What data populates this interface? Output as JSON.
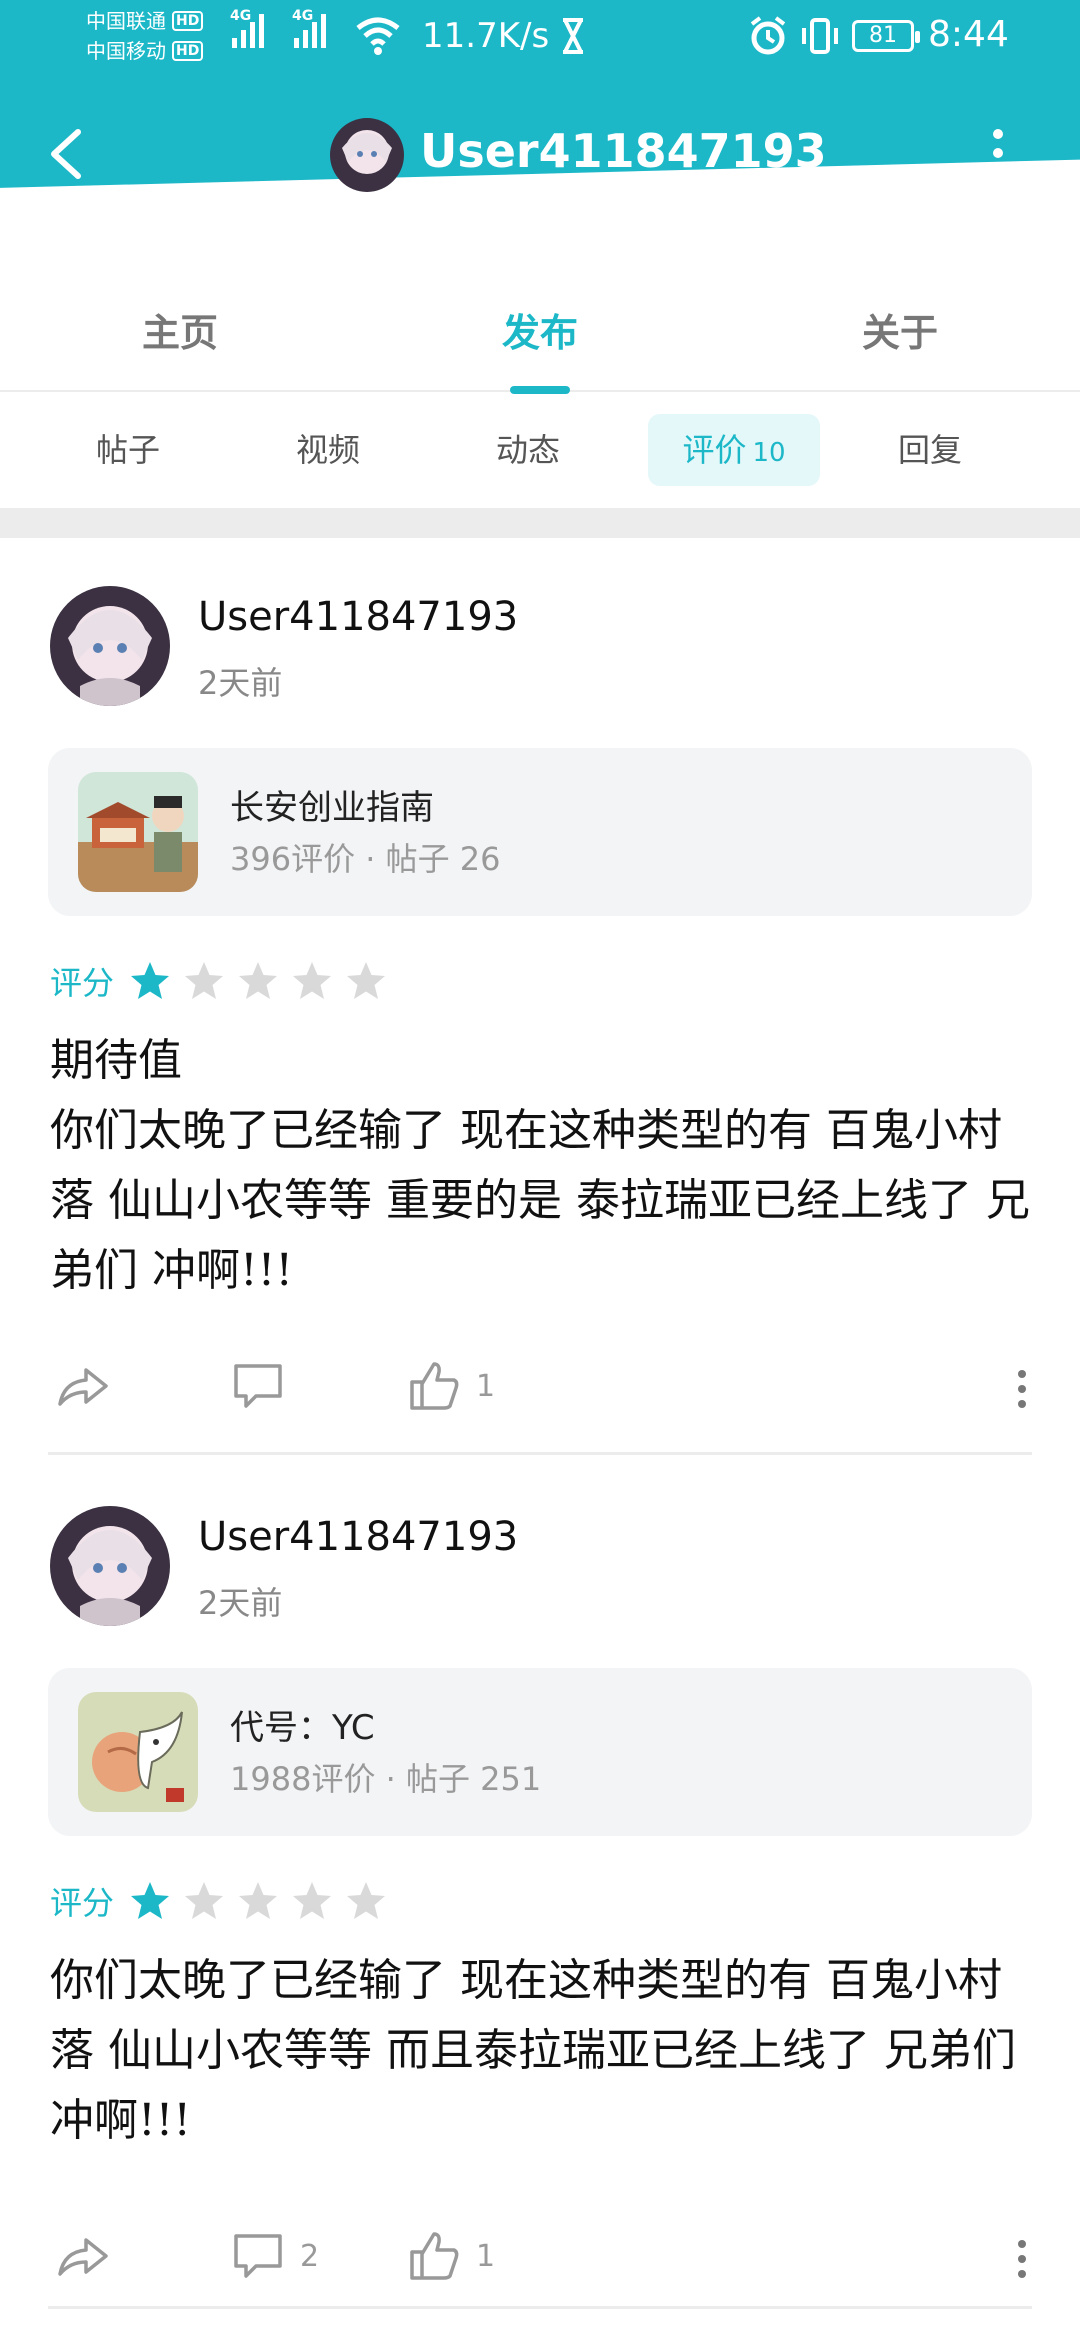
{
  "status_bar": {
    "carrier1": "中国联通",
    "carrier2": "中国移动",
    "hd": "HD",
    "net": "4G",
    "speed": "11.7K/s",
    "battery": "81",
    "time": "8:44"
  },
  "header": {
    "username": "User411847193",
    "back_icon": "chevron-left-icon",
    "more_icon": "more-vertical-icon"
  },
  "tabs": [
    {
      "label": "主页",
      "active": false
    },
    {
      "label": "发布",
      "active": true
    },
    {
      "label": "关于",
      "active": false
    }
  ],
  "subtabs": [
    {
      "label": "帖子",
      "count": "",
      "active": false
    },
    {
      "label": "视频",
      "count": "",
      "active": false
    },
    {
      "label": "动态",
      "count": "",
      "active": false
    },
    {
      "label": "评价",
      "count": "10",
      "active": true
    },
    {
      "label": "回复",
      "count": "",
      "active": false
    }
  ],
  "reviews": [
    {
      "username": "User411847193",
      "time": "2天前",
      "game": {
        "name": "长安创业指南",
        "meta": "396评价 · 帖子 26"
      },
      "rating_label": "评分",
      "rating": 1,
      "rating_max": 5,
      "text": "期待值\n你们太晚了已经输了 现在这种类型的有 百鬼小村落 仙山小农等等 重要的是 泰拉瑞亚已经上线了 兄弟们 冲啊!!!",
      "comments": "",
      "likes": "1"
    },
    {
      "username": "User411847193",
      "time": "2天前",
      "game": {
        "name": "代号：YC",
        "meta": "1988评价 · 帖子 251"
      },
      "rating_label": "评分",
      "rating": 1,
      "rating_max": 5,
      "text": "你们太晚了已经输了 现在这种类型的有 百鬼小村落 仙山小农等等 而且泰拉瑞亚已经上线了 兄弟们 冲啊!!!",
      "comments": "2",
      "likes": "1"
    }
  ],
  "colors": {
    "accent": "#1cb8c8",
    "star_off": "#d9d9d9",
    "muted": "#999999"
  }
}
